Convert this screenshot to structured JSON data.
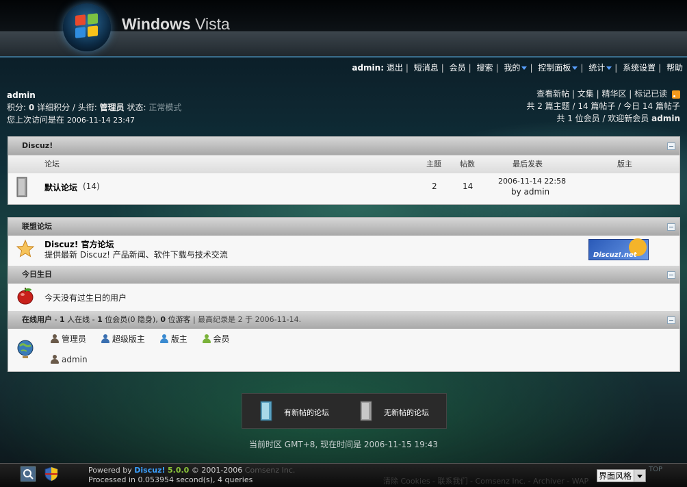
{
  "header": {
    "logo_brand": "Windows",
    "logo_product": "Vista"
  },
  "topnav": {
    "user": "admin",
    "items": [
      "退出",
      "短消息",
      "会员",
      "搜索",
      "我的",
      "控制面板",
      "统计",
      "系统设置",
      "帮助"
    ]
  },
  "userinfo": {
    "name": "admin",
    "points_label": "积分:",
    "points_value": "0",
    "detail_label": "详细积分",
    "title_label": "头衔:",
    "title_value": "管理员",
    "status_label": "状态:",
    "status_value": "正常模式",
    "last_visit_label": "您上次访问是在",
    "last_visit_value": "2006-11-14 23:47"
  },
  "stats": {
    "links": [
      "查看新帖",
      "文集",
      "精华区",
      "标记已读"
    ],
    "line2": "共 2 篇主题 / 14 篇帖子 / 今日 14 篇帖子",
    "line3_prefix": "共 1 位会员 / 欢迎新会员",
    "newest_member": "admin"
  },
  "forum_panel": {
    "title": "Discuz!",
    "columns": {
      "forum": "论坛",
      "topics": "主题",
      "posts": "帖数",
      "last_post": "最后发表",
      "moderator": "版主"
    },
    "rows": [
      {
        "name": "默认论坛",
        "count": "(14)",
        "topics": "2",
        "posts": "14",
        "last_time": "2006-11-14 22:58",
        "last_by": "by admin",
        "moderator": ""
      }
    ]
  },
  "league_panel": {
    "title": "联盟论坛",
    "name": "Discuz! 官方论坛",
    "desc": "提供最新 Discuz! 产品新闻、软件下载与技术交流",
    "banner_text": "Discuz!.net"
  },
  "birthday_panel": {
    "title": "今日生日",
    "text": "今天没有过生日的用户"
  },
  "online_panel": {
    "title": "在线用户",
    "summary_strong_1": "1",
    "summary_mid": "人在线 - ",
    "summary_strong_2": "1",
    "summary_mid_2": "位会员(0 隐身), ",
    "summary_strong_3": "0",
    "summary_end": "位游客",
    "record": "| 最高纪录是 2 于 2006-11-14.",
    "legend": [
      {
        "label": "管理员",
        "color": "#6a5a4a"
      },
      {
        "label": "超级版主",
        "color": "#3a6fb0"
      },
      {
        "label": "版主",
        "color": "#3a8ad0"
      },
      {
        "label": "会员",
        "color": "#7ab23a"
      }
    ],
    "users": [
      {
        "name": "admin",
        "color": "#6a5a4a"
      }
    ]
  },
  "legend_box": {
    "new": "有新帖的论坛",
    "none": "无新帖的论坛"
  },
  "timezone": "当前时区 GMT+8, 现在时间是 2006-11-15 19:43",
  "footer": {
    "powered_prefix": "Powered by",
    "brand": "Discuz!",
    "version": "5.0.0",
    "copyright": "© 2001-2006",
    "company": "Comsenz Inc.",
    "processed": "Processed in 0.053954 second(s), 4 queries",
    "links": "清除 Cookies - 联系我们 - Comsenz Inc. - Archiver - WAP",
    "style_select": "界面风格",
    "top": "TOP"
  }
}
